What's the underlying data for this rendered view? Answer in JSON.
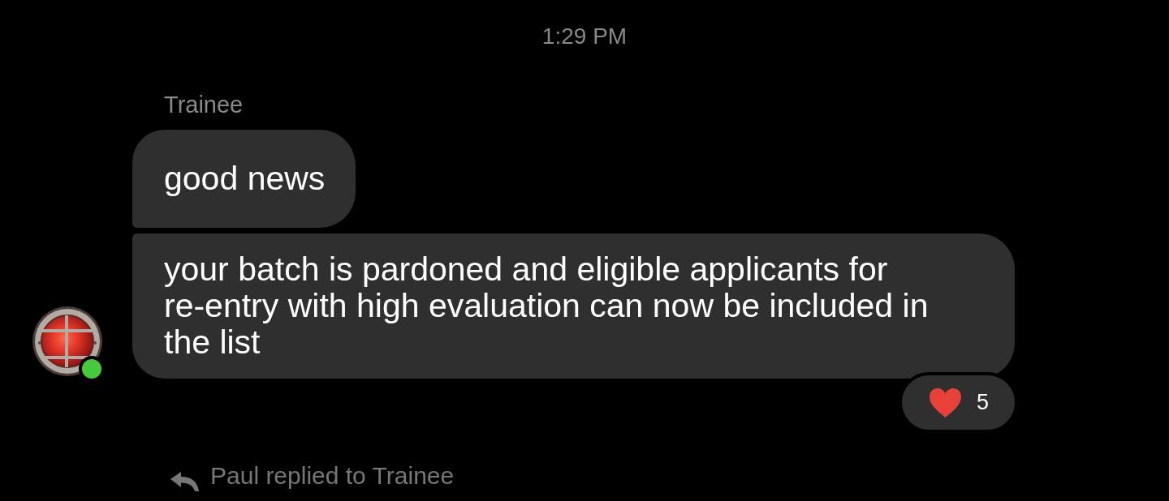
{
  "timestamp": "1:29 PM",
  "message_group": {
    "sender": "Trainee",
    "avatar": {
      "online": true
    },
    "messages": [
      {
        "text": "good news"
      },
      {
        "text": "your batch is pardoned and eligible applicants for re-entry with high evaluation can now be included in the list",
        "reactions": [
          {
            "count": "5"
          }
        ]
      }
    ]
  },
  "reply_notice": {
    "text": "Paul replied to Trainee"
  }
}
